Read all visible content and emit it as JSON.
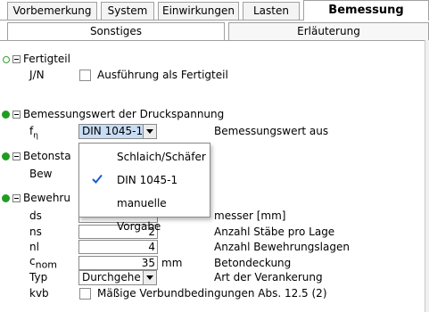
{
  "tabs": [
    {
      "label": "Vorbemerkung",
      "active": false
    },
    {
      "label": "System",
      "active": false
    },
    {
      "label": "Einwirkungen",
      "active": false
    },
    {
      "label": "Lasten",
      "active": false
    },
    {
      "label": "Bemessung",
      "active": true
    }
  ],
  "subtabs": [
    {
      "label": "Sonstiges",
      "active": true
    },
    {
      "label": "Erläuterung",
      "active": false
    }
  ],
  "fertigteil": {
    "header": "Fertigteil",
    "jn_label": "J/N",
    "checkbox_label": "Ausführung als Fertigteil"
  },
  "druck": {
    "header": "Bemessungswert der Druckspannung",
    "fn_label": "f",
    "fn_sub": "η",
    "combo_value": "DIN 1045-1",
    "desc": "Bemessungswert aus"
  },
  "beton": {
    "header": "Betonsta",
    "bew_label": "Bew"
  },
  "bewehrung": {
    "header": "Bewehru",
    "rows": [
      {
        "sym": "ds",
        "value": "",
        "desc": "messer [mm]"
      },
      {
        "sym": "ns",
        "value": "2",
        "desc": "Anzahl Stäbe pro Lage"
      },
      {
        "sym": "nl",
        "value": "4",
        "desc": "Anzahl Bewehrungslagen"
      },
      {
        "sym": "c",
        "sym_sub": "nom",
        "value": "35",
        "unit": "mm",
        "desc": "Betondeckung"
      }
    ],
    "typ_label": "Typ",
    "typ_value": "Durchgehe",
    "typ_desc": "Art der Verankerung",
    "kvb_label": "kvb",
    "kvb_checkbox_label": "Mäßige Verbundbedingungen Abs. 12.5 (2)"
  },
  "dropdown": {
    "items": [
      {
        "label": "Schlaich/Schäfer",
        "checked": false
      },
      {
        "label": "DIN 1045-1",
        "checked": true
      },
      {
        "label": "manuelle Vorgabe",
        "checked": false
      }
    ]
  },
  "colors": {
    "status_green": "#1f9d1f",
    "check_blue": "#1a5bd6",
    "selection": "#c8dcf4"
  }
}
